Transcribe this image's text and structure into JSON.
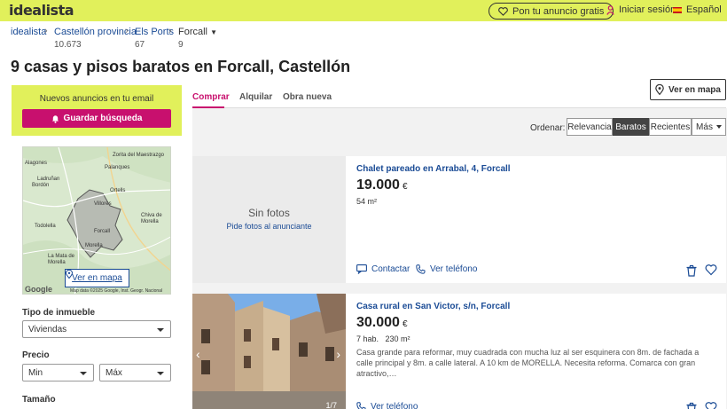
{
  "header": {
    "logo": "idealista",
    "ad_button": "Pon tu anuncio gratis",
    "login": "Iniciar sesión",
    "language": "Español"
  },
  "breadcrumb": [
    {
      "label": "idealista",
      "count": ""
    },
    {
      "label": "Castellón provincia",
      "count": "10.673"
    },
    {
      "label": "Els Ports",
      "count": "67"
    },
    {
      "label": "Forcall",
      "count": "9"
    }
  ],
  "page_title": "9 casas y pisos baratos en Forcall, Castellón",
  "alert": {
    "title": "Nuevos anuncios en tu email",
    "button": "Guardar búsqueda"
  },
  "map": {
    "button": "Ver en mapa",
    "labels": [
      "Alagones",
      "Zorita del Maestrazgo",
      "Palanques",
      "Ladruñan",
      "Bordón",
      "Ortells",
      "Villores",
      "Chiva de Morella",
      "Forcall",
      "Todolella",
      "La Mata de Morella",
      "Morella"
    ],
    "google": "Google",
    "attribution": "Map data ©2025 Google, Inst. Geogr. Nacional"
  },
  "filters": {
    "tipo_label": "Tipo de inmueble",
    "tipo_value": "Viviendas",
    "precio_label": "Precio",
    "precio_min": "Min",
    "precio_max": "Máx",
    "tamano_label": "Tamaño"
  },
  "tabs": [
    "Comprar",
    "Alquilar",
    "Obra nueva"
  ],
  "map_button": "Ver en mapa",
  "sort": {
    "label": "Ordenar:",
    "options": [
      "Relevancia",
      "Baratos",
      "Recientes",
      "Más"
    ],
    "active": "Baratos"
  },
  "listings": [
    {
      "title": "Chalet pareado en Arrabal, 4, Forcall",
      "price": "19.000",
      "currency": "€",
      "details": "54 m²",
      "no_photo_title": "Sin fotos",
      "no_photo_link": "Pide fotos al anunciante",
      "contact": "Contactar",
      "phone": "Ver teléfono"
    },
    {
      "title": "Casa rural en San Victor, s/n, Forcall",
      "price": "30.000",
      "currency": "€",
      "details": "7 hab.   230 m²",
      "description": "Casa grande para reformar, muy cuadrada con mucha luz al ser esquinera con 8m. de fachada a calle principal y 8m. a calle lateral. A 10 km de MORELLA. Necesita reforma. Comarca con gran atractivo,…",
      "photo_counter": "1/7",
      "phone": "Ver teléfono"
    }
  ],
  "colors": {
    "brand_yellow": "#e1f05b",
    "accent_magenta": "#c8106e",
    "link_blue": "#1a4b95"
  }
}
